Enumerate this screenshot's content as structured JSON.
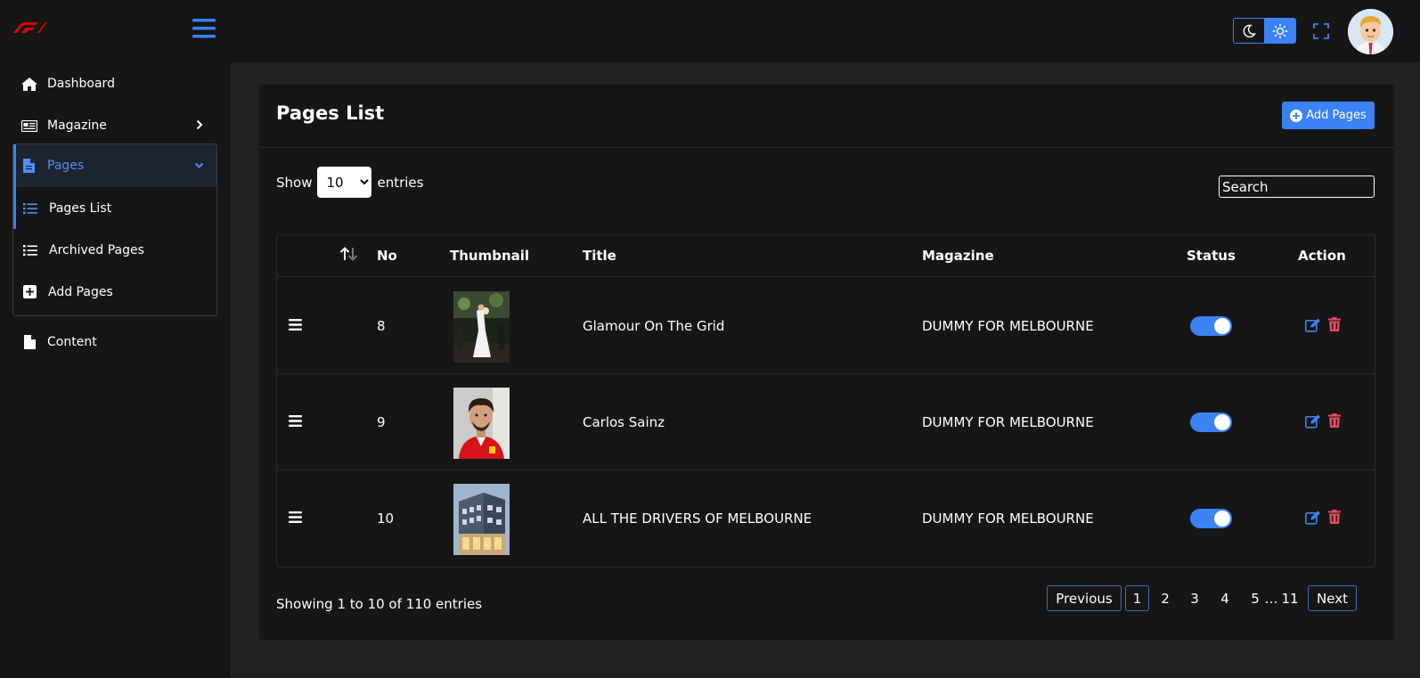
{
  "topbar": {
    "icons": [
      "f1-logo-icon",
      "hamburger-icon",
      "moon-icon",
      "sun-icon",
      "fullscreen-icon",
      "avatar"
    ]
  },
  "sidebar": {
    "items": [
      {
        "label": "Dashboard",
        "icon": "home-icon"
      },
      {
        "label": "Magazine",
        "icon": "newspaper-icon"
      },
      {
        "label": "Pages",
        "icon": "file-icon"
      },
      {
        "label": "Content",
        "icon": "file-icon"
      }
    ],
    "pages_submenu": [
      {
        "label": "Pages List",
        "icon": "list-icon"
      },
      {
        "label": "Archived Pages",
        "icon": "list-icon"
      },
      {
        "label": "Add Pages",
        "icon": "plus-square-icon"
      }
    ]
  },
  "card": {
    "title": "Pages List",
    "add_button": "Add Pages"
  },
  "controls": {
    "show_label": "Show",
    "entries_label": "entries",
    "page_size": "10",
    "search_placeholder": "Search"
  },
  "table": {
    "headers": [
      "No",
      "Thumbnail",
      "Title",
      "Magazine",
      "Status",
      "Action"
    ],
    "rows": [
      {
        "no": "8",
        "title": "Glamour On The Grid",
        "magazine": "DUMMY FOR MELBOURNE",
        "status": true
      },
      {
        "no": "9",
        "title": "Carlos Sainz",
        "magazine": "DUMMY FOR MELBOURNE",
        "status": true
      },
      {
        "no": "10",
        "title": "ALL THE DRIVERS OF MELBOURNE",
        "magazine": "DUMMY FOR MELBOURNE",
        "status": true
      }
    ]
  },
  "footer": {
    "info": "Showing 1 to 10 of 110 entries",
    "pagination": {
      "previous": "Previous",
      "pages": [
        "1",
        "2",
        "3",
        "4",
        "5"
      ],
      "ellipsis": "…",
      "last": "11",
      "next": "Next",
      "current": "1"
    }
  },
  "colors": {
    "accent": "#3b82f6",
    "danger": "#e84a5f",
    "background": "#222222",
    "panel": "#161616"
  }
}
